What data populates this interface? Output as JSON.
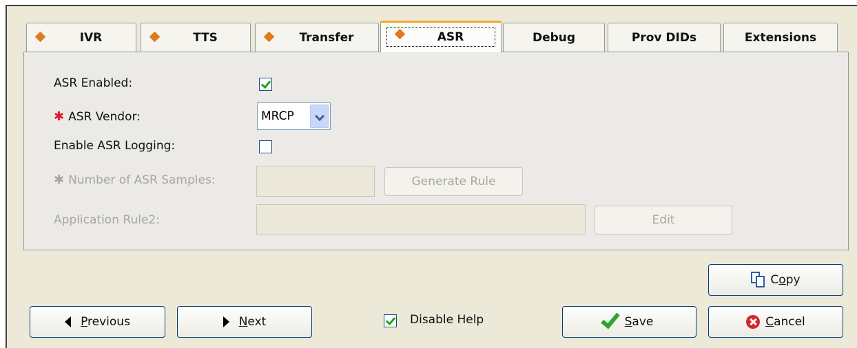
{
  "tabs": [
    {
      "label": "IVR",
      "bullet": true
    },
    {
      "label": "TTS",
      "bullet": true
    },
    {
      "label": "Transfer",
      "bullet": true
    },
    {
      "label": "ASR",
      "bullet": true,
      "active": true
    },
    {
      "label": "Debug",
      "bullet": false
    },
    {
      "label": "Prov DIDs",
      "bullet": false
    },
    {
      "label": "Extensions",
      "bullet": false
    }
  ],
  "form": {
    "asr_enabled": {
      "label": "ASR Enabled:",
      "checked": true
    },
    "asr_vendor": {
      "label": "ASR Vendor:",
      "value": "MRCP",
      "required": true
    },
    "asr_logging": {
      "label": "Enable ASR Logging:",
      "checked": false
    },
    "asr_samples": {
      "label": "Number of ASR Samples:",
      "value": "",
      "required": true,
      "disabled": true
    },
    "generate_rule": {
      "label": "Generate Rule",
      "disabled": true
    },
    "application_rule": {
      "label": "Application Rule2:",
      "value": "",
      "disabled": true
    },
    "edit": {
      "label": "Edit",
      "disabled": true
    }
  },
  "footer": {
    "copy": {
      "label": "Copy",
      "mnemonic": "o",
      "pre": "C",
      "post": "py"
    },
    "previous": {
      "pre": "",
      "mnemonic": "P",
      "post": "revious"
    },
    "next": {
      "pre": "",
      "mnemonic": "N",
      "post": "ext"
    },
    "disable_help": {
      "label": "Disable Help",
      "checked": true
    },
    "save": {
      "pre": "",
      "mnemonic": "S",
      "post": "ave"
    },
    "cancel": {
      "pre": "",
      "mnemonic": "C",
      "post": "ancel"
    }
  },
  "colors": {
    "accent": "#f6a623",
    "bullet": "#e07b1c",
    "required": "#e8132c",
    "check": "#21a121",
    "window": "#ece9d8"
  }
}
